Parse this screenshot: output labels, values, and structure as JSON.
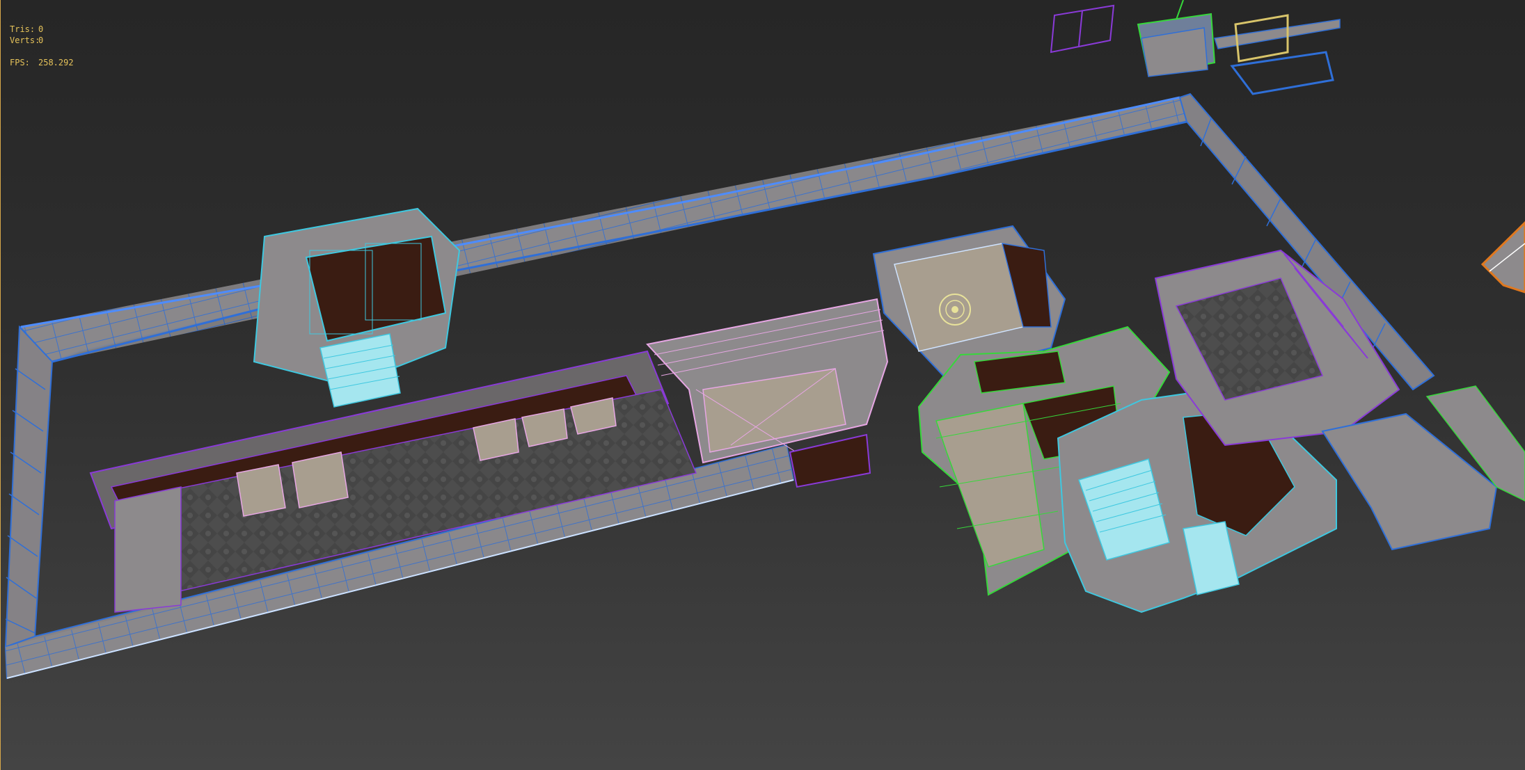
{
  "viewport": {
    "stats": {
      "tris_label": "Tris:",
      "tris_value": "0",
      "verts_label": "Verts:",
      "verts_value": "0",
      "fps_label": "FPS:",
      "fps_value": "258.292"
    }
  },
  "colors": {
    "background": "#2f2f2f",
    "stats_text": "#e6c35a",
    "wire_blue": "#2f6fd8",
    "wire_cyan": "#3ec8e0",
    "wire_purple": "#8a3ad8",
    "wire_pink": "#e7a6e4",
    "wire_green": "#36d83a",
    "wire_orange": "#e0781e",
    "wire_yellow": "#d8c46a",
    "surface_gray": "#8d8a8c",
    "floor_dark": "#4a4a4a",
    "floor_beige": "#a89e8f",
    "wood_dark": "#3a1c12"
  }
}
